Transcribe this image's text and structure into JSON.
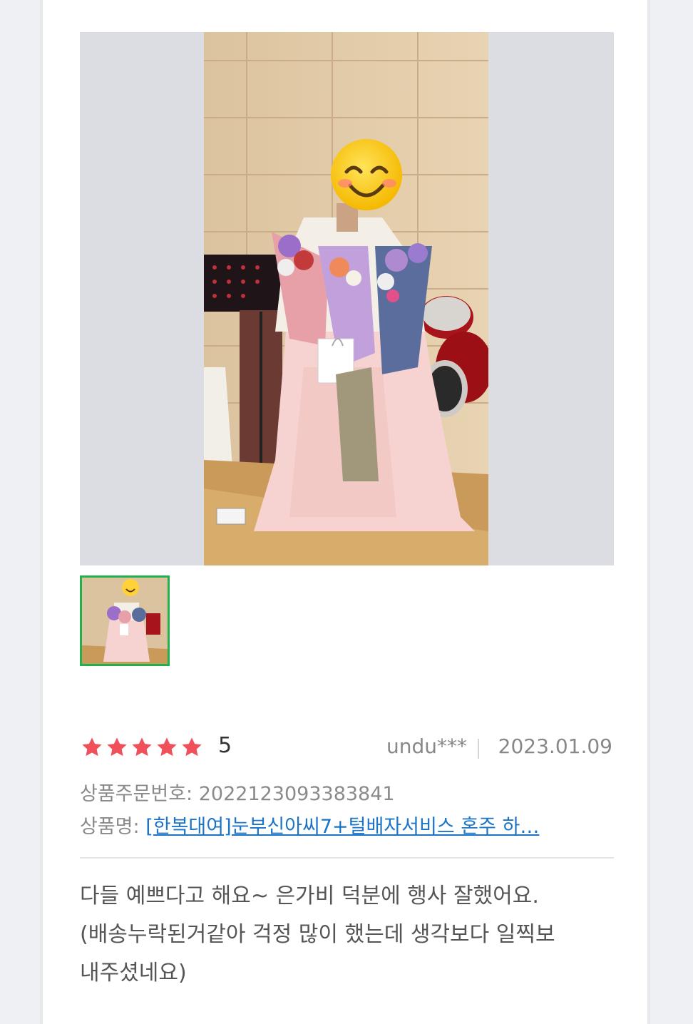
{
  "review": {
    "rating_value": 5,
    "rating_text": "5",
    "stars_count": 5,
    "author": "undu***",
    "date": "2023.01.09",
    "order_label": "상품주문번호:",
    "order_number": "2022123093383841",
    "product_label": "상품명:",
    "product_name": "[한복대여]눈부신아씨7+털배자서비스 혼주 하…",
    "body_line1": "다들 예쁘다고 해요~ 은가비 덕분에 행사 잘했어요.",
    "body_line2": "(배송누락된거같아 걱정 많이 했는데 생각보다 일찍보",
    "body_line3": "내주셨네요)"
  },
  "colors": {
    "star": "#f0505a",
    "link": "#1b74c7",
    "thumb_border": "#22b14c"
  },
  "icons": {
    "star": "star-icon",
    "face": "smiley-face-sticker"
  }
}
